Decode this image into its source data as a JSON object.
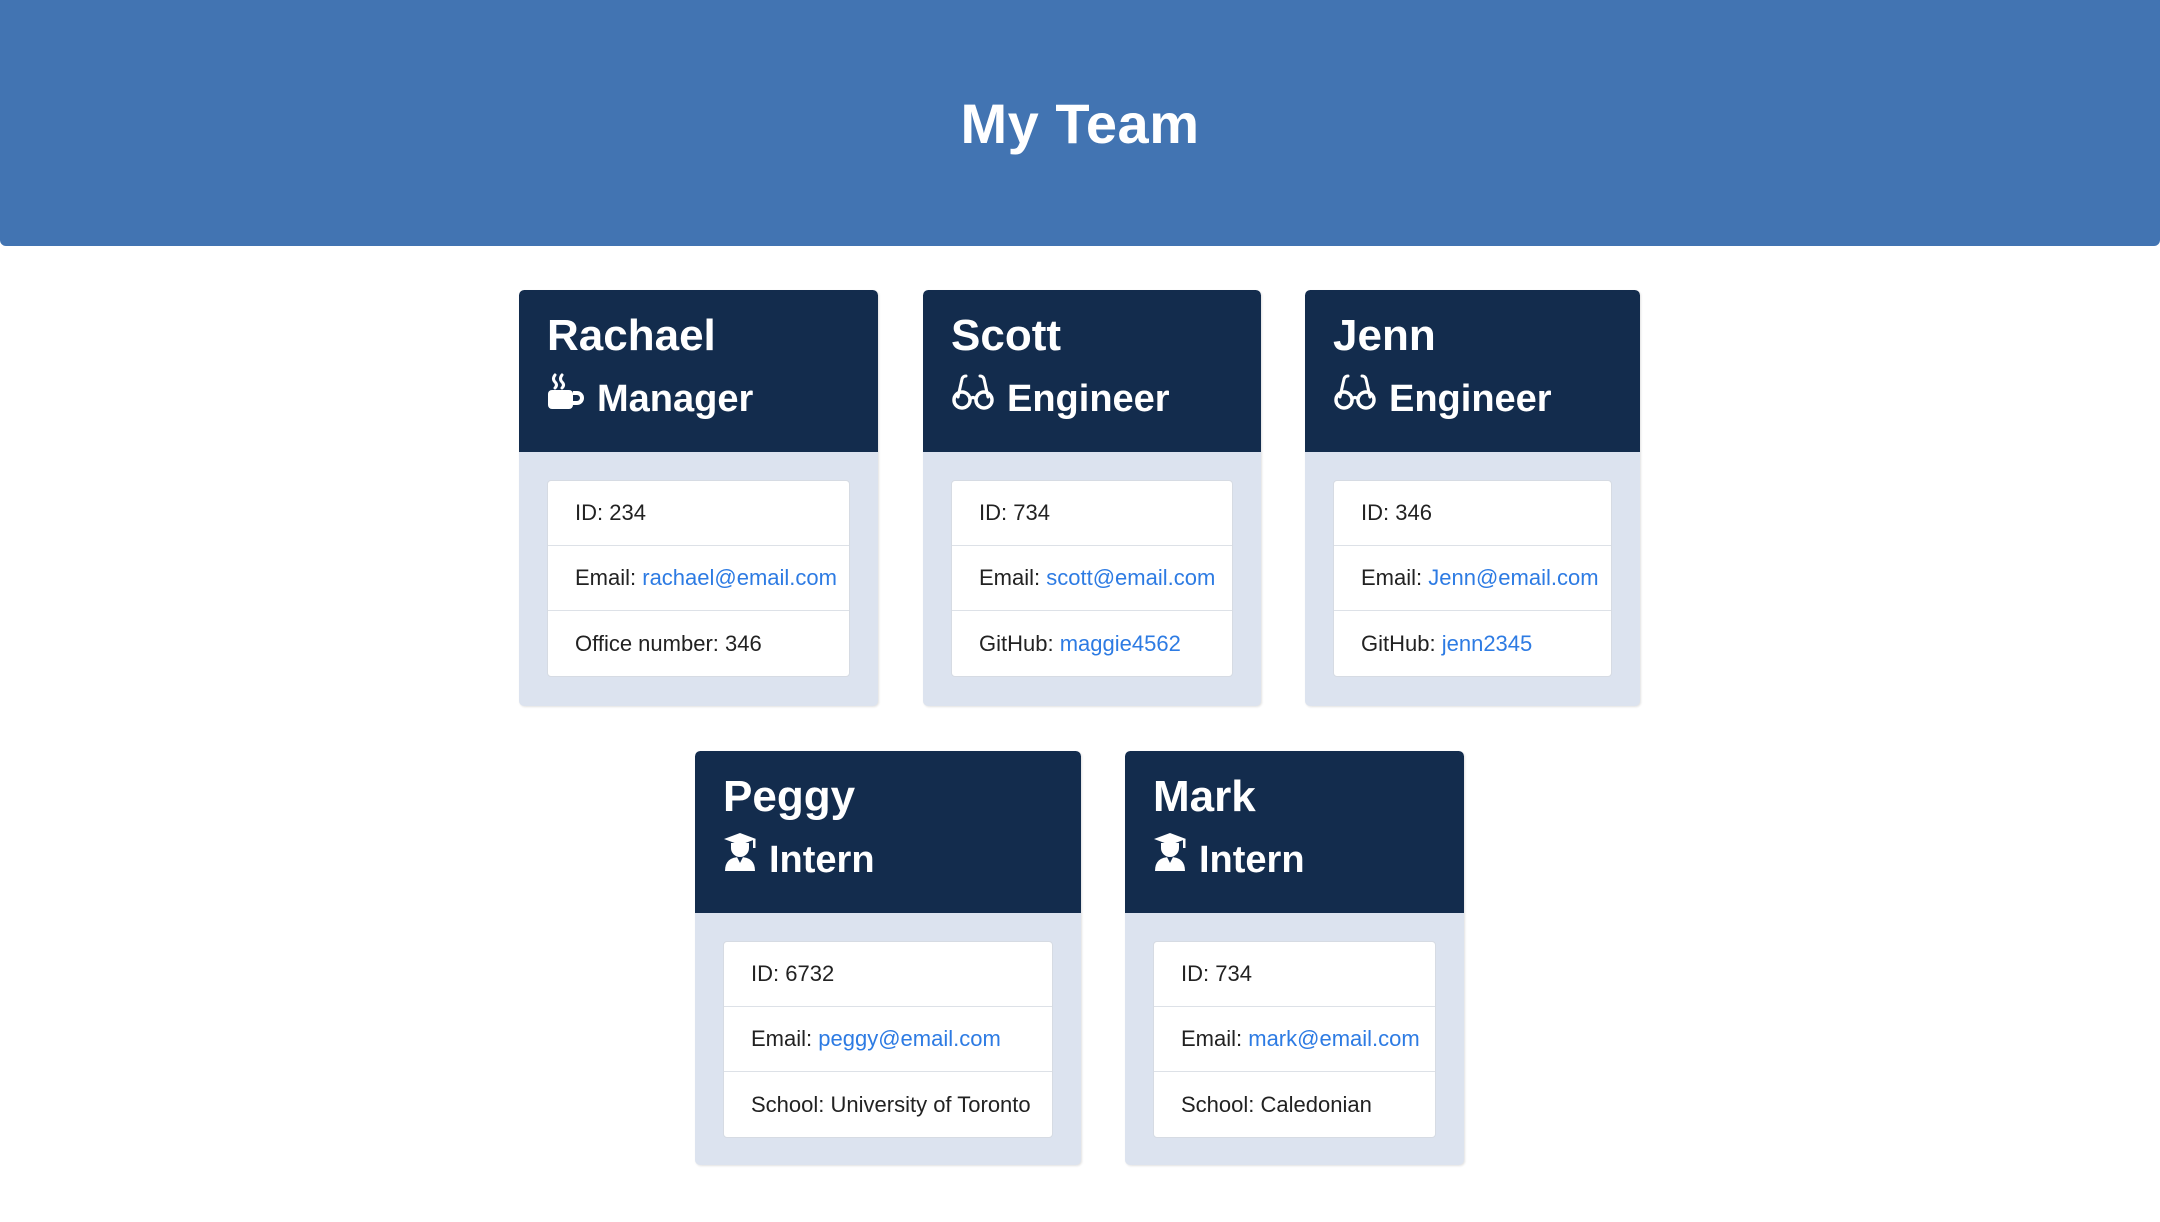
{
  "header": {
    "title": "My Team"
  },
  "team": [
    {
      "name": "Rachael",
      "role": "Manager",
      "icon": "mug-hot-icon",
      "id_label": "ID:",
      "id": "234",
      "email_label": "Email:",
      "email": "rachael@email.com",
      "extra_label": "Office number:",
      "extra_value": "346"
    },
    {
      "name": "Scott",
      "role": "Engineer",
      "icon": "glasses-icon",
      "id_label": "ID:",
      "id": "734",
      "email_label": "Email:",
      "email": "scott@email.com",
      "extra_label": "GitHub:",
      "extra_value": "maggie4562"
    },
    {
      "name": "Jenn",
      "role": "Engineer",
      "icon": "glasses-icon",
      "id_label": "ID:",
      "id": "346",
      "email_label": "Email:",
      "email": "Jenn@email.com",
      "extra_label": "GitHub:",
      "extra_value": "jenn2345"
    },
    {
      "name": "Peggy",
      "role": "Intern",
      "icon": "user-graduate-icon",
      "id_label": "ID:",
      "id": "6732",
      "email_label": "Email:",
      "email": "peggy@email.com",
      "extra_label": "School:",
      "extra_value": "University of Toronto"
    },
    {
      "name": "Mark",
      "role": "Intern",
      "icon": "user-graduate-icon",
      "id_label": "ID:",
      "id": "734",
      "email_label": "Email:",
      "email": "mark@email.com",
      "extra_label": "School:",
      "extra_value": "Caledonian"
    }
  ],
  "colors": {
    "header_bg": "#4274b2",
    "card_head_bg": "#132c4d",
    "card_body_bg": "#dce3ef",
    "link": "#2d7be3"
  }
}
